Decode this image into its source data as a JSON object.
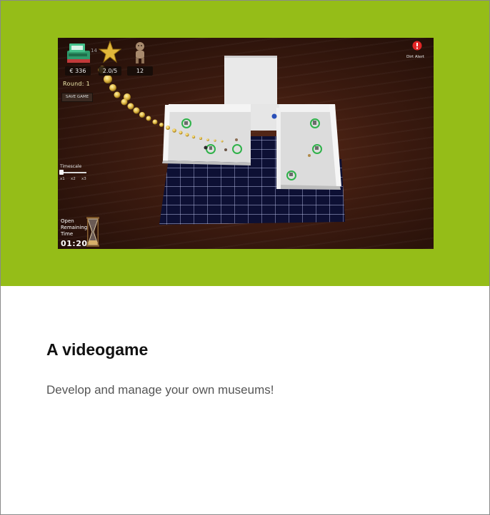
{
  "card": {
    "title": "A videogame",
    "description": "Develop and manage your own museums!"
  },
  "game_hud": {
    "money": "€ 336",
    "money_faded": "14",
    "stars": "2.0/5",
    "visitors": "12",
    "round": "Round: 1",
    "save_button": "SAVE GAME",
    "alert_label": "Dirt Alert",
    "timescale_label": "Timescale",
    "timescale_options": [
      "x1",
      "x2",
      "x3"
    ],
    "open_label_1": "Open",
    "open_label_2": "Remaining",
    "open_label_3": "Time",
    "timer": "01:20"
  },
  "colors": {
    "hero_background": "#95bd18",
    "marker_green": "#2fb24a",
    "alert_red": "#e32626"
  },
  "icons": [
    "cash-register-icon",
    "star-icon",
    "visitor-doll-icon",
    "alert-icon",
    "hourglass-icon",
    "coin-icon",
    "exhibit-marker-icon",
    "visitor-icon"
  ]
}
